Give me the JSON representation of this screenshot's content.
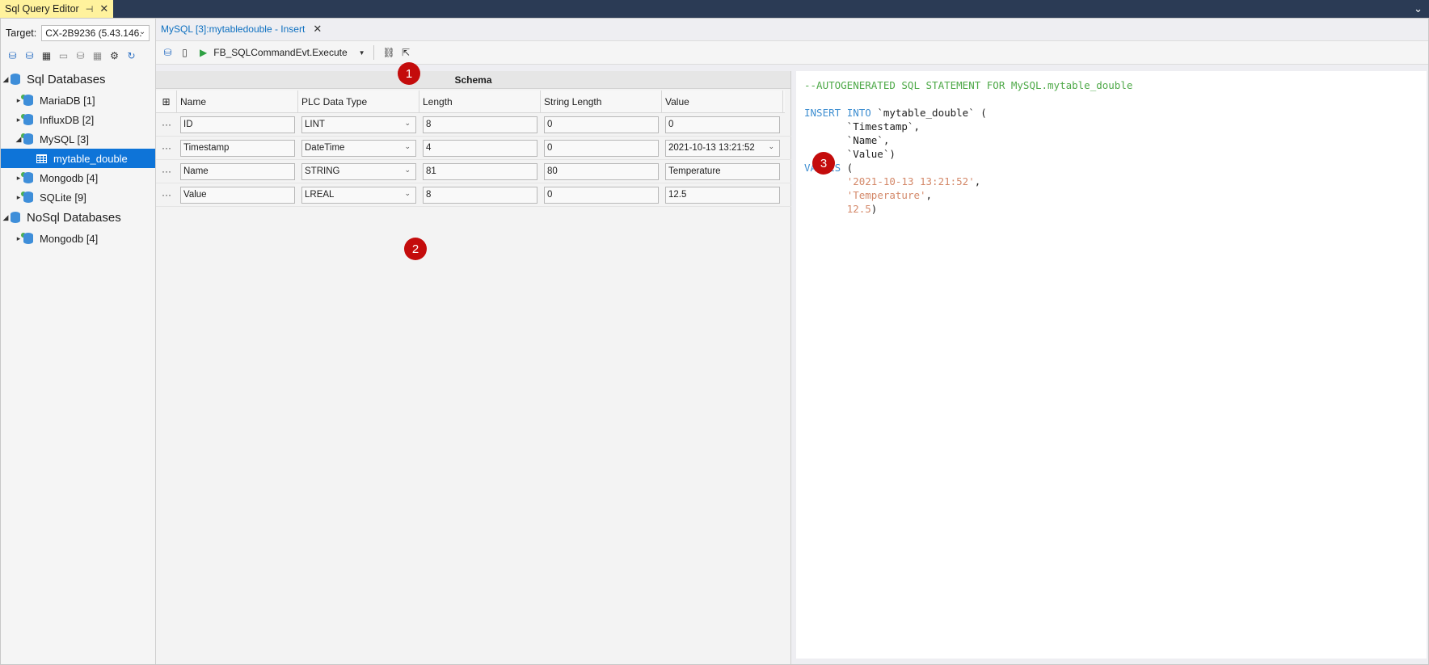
{
  "tool_window": {
    "title": "Sql Query Editor",
    "pin_glyph": "⊣",
    "close_glyph": "✕"
  },
  "window_chevron": "⌄",
  "target": {
    "label": "Target:",
    "value": "CX-2B9236 (5.43.146."
  },
  "tree": {
    "sql_group": "Sql Databases",
    "sql_items": [
      {
        "label": "MariaDB [1]"
      },
      {
        "label": "InfluxDB [2]"
      },
      {
        "label": "MySQL [3]"
      },
      {
        "label": "mytable_double"
      },
      {
        "label": "Mongodb [4]"
      },
      {
        "label": "SQLite [9]"
      }
    ],
    "nosql_group": "NoSql Databases",
    "nosql_items": [
      {
        "label": "Mongodb [4]"
      }
    ]
  },
  "doc_tab": {
    "title": "MySQL [3]:mytabledouble - Insert",
    "close_glyph": "✕"
  },
  "doc_toolbar": {
    "command": "FB_SQLCommandEvt.Execute"
  },
  "badges": {
    "one": "1",
    "two": "2",
    "three": "3"
  },
  "schema": {
    "title": "Schema",
    "columns": [
      "Name",
      "PLC Data Type",
      "Length",
      "String Length",
      "Value"
    ],
    "rows": [
      {
        "name": "ID",
        "type": "LINT",
        "length": "8",
        "string_length": "0",
        "value": "0"
      },
      {
        "name": "Timestamp",
        "type": "DateTime",
        "length": "4",
        "string_length": "0",
        "value": "2021-10-13 13:21:52"
      },
      {
        "name": "Name",
        "type": "STRING",
        "length": "81",
        "string_length": "80",
        "value": "Temperature"
      },
      {
        "name": "Value",
        "type": "LREAL",
        "length": "8",
        "string_length": "0",
        "value": "12.5"
      }
    ]
  },
  "sql": {
    "comment": "--AUTOGENERATED SQL STATEMENT FOR MySQL.mytable_double",
    "insert_kw": "INSERT",
    "into_kw": "INTO",
    "table_part": " `mytable_double` (",
    "col1": "       `Timestamp`,",
    "col2": "       `Name`,",
    "col3": "       `Value`)",
    "values_kw": "VALUES",
    "values_open": " (",
    "val1_indent": "       ",
    "val1": "'2021-10-13 13:21:52'",
    "val1_end": ",",
    "val2_indent": "       ",
    "val2": "'Temperature'",
    "val2_end": ",",
    "val3_indent": "       ",
    "val3": "12.5",
    "val3_end": ")"
  },
  "colors": {
    "accent": "#0e74d8",
    "badge": "#c40c0c",
    "title_bar": "#2b3b55",
    "tool_tab": "#fff29d"
  }
}
